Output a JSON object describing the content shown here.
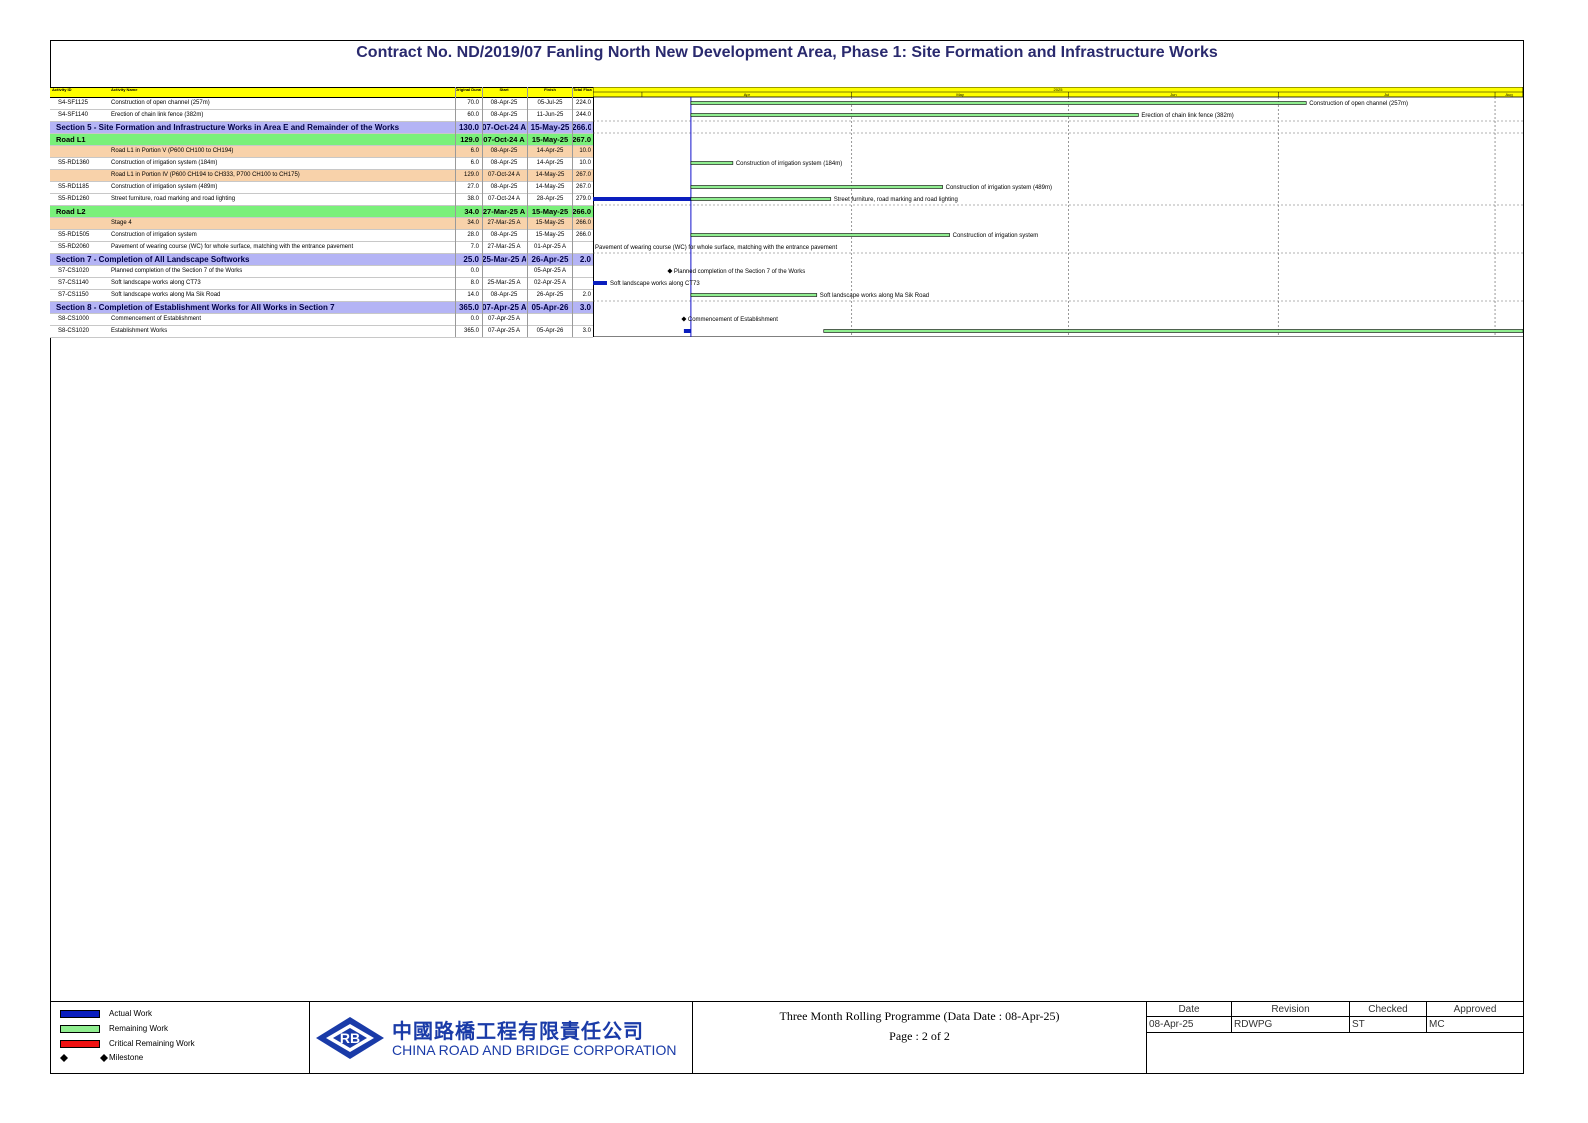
{
  "title": "Contract No. ND/2019/07 Fanling North New Development Area, Phase 1: Site Formation and Infrastructure Works",
  "table_header": {
    "id": "Activity ID",
    "name": "Activity Name",
    "duration": "Original Duration",
    "start": "Start",
    "finish": "Finish",
    "float": "Total Float"
  },
  "timeline": {
    "year": "2025",
    "months": [
      "Apr",
      "May",
      "Jun",
      "Jul",
      "Aug"
    ]
  },
  "chart_data": {
    "type": "gantt",
    "data_date": "2025-04-08",
    "axis_start": "2025-03-25",
    "axis_end": "2025-08-05",
    "rows": [
      {
        "kind": "act",
        "id": "S4-SF1125",
        "name": "Construction of open channel (257m)",
        "duration": "70.0",
        "start": "08-Apr-25",
        "finish": "05-Jul-25",
        "float": "224.0",
        "bar_start": "2025-04-08",
        "bar_end": "2025-07-05",
        "label": "Construction of open channel (257m)"
      },
      {
        "kind": "act",
        "id": "S4-SF1140",
        "name": "Erection of chain link fence (382m)",
        "duration": "60.0",
        "start": "08-Apr-25",
        "finish": "11-Jun-25",
        "float": "244.0",
        "bar_start": "2025-04-08",
        "bar_end": "2025-06-11",
        "label": "Erection of chain link fence (382m)"
      },
      {
        "kind": "section",
        "name": "Section 5 - Site Formation and Infrastructure Works in Area E and Remainder of the Works",
        "duration": "130.0",
        "start": "07-Oct-24 A",
        "finish": "15-May-25",
        "float": "266.0"
      },
      {
        "kind": "road",
        "name": "Road L1",
        "duration": "129.0",
        "start": "07-Oct-24 A",
        "finish": "15-May-25",
        "float": "267.0"
      },
      {
        "kind": "portion",
        "name": "Road L1 in Portion V (P600 CH100 to CH194)",
        "duration": "6.0",
        "start": "08-Apr-25",
        "finish": "14-Apr-25",
        "float": "10.0"
      },
      {
        "kind": "act",
        "id": "S5-RD1360",
        "name": "Construction of irrigation system (184m)",
        "duration": "6.0",
        "start": "08-Apr-25",
        "finish": "14-Apr-25",
        "float": "10.0",
        "bar_start": "2025-04-08",
        "bar_end": "2025-04-14",
        "label": "Construction of irrigation system (184m)"
      },
      {
        "kind": "portion",
        "name": "Road L1 in Portion IV (P600 CH194 to CH333, P700 CH100 to CH175)",
        "duration": "129.0",
        "start": "07-Oct-24 A",
        "finish": "14-May-25",
        "float": "267.0"
      },
      {
        "kind": "act",
        "id": "S5-RD1185",
        "name": "Construction of irrigation system (489m)",
        "duration": "27.0",
        "start": "08-Apr-25",
        "finish": "14-May-25",
        "float": "267.0",
        "bar_start": "2025-04-08",
        "bar_end": "2025-05-14",
        "label": "Construction of irrigation system (489m)"
      },
      {
        "kind": "act",
        "id": "S5-RD1260",
        "name": "Street furniture, road marking and road lighting",
        "duration": "38.0",
        "start": "07-Oct-24 A",
        "finish": "28-Apr-25",
        "float": "279.0",
        "bar_start": "2025-04-08",
        "bar_end": "2025-04-28",
        "actual_start": "2025-03-25",
        "label": "Street furniture, road marking and road lighting"
      },
      {
        "kind": "road",
        "name": "Road L2",
        "duration": "34.0",
        "start": "27-Mar-25 A",
        "finish": "15-May-25",
        "float": "266.0"
      },
      {
        "kind": "portion",
        "name": "Stage 4",
        "duration": "34.0",
        "start": "27-Mar-25 A",
        "finish": "15-May-25",
        "float": "266.0"
      },
      {
        "kind": "act",
        "id": "S5-RD1505",
        "name": "Construction of irrigation system",
        "duration": "28.0",
        "start": "08-Apr-25",
        "finish": "15-May-25",
        "float": "266.0",
        "bar_start": "2025-04-08",
        "bar_end": "2025-05-15",
        "label": "Construction of irrigation system"
      },
      {
        "kind": "act",
        "id": "S5-RD2060",
        "name": "Pavement of wearing course (WC) for whole surface, matching with the entrance pavement",
        "duration": "7.0",
        "start": "27-Mar-25 A",
        "finish": "01-Apr-25 A",
        "float": "",
        "label": "Pavement of wearing course (WC) for whole surface, matching with the entrance pavement"
      },
      {
        "kind": "section",
        "name": "Section 7 - Completion of All Landscape Softworks",
        "duration": "25.0",
        "start": "25-Mar-25 A",
        "finish": "26-Apr-25",
        "float": "2.0"
      },
      {
        "kind": "act",
        "id": "S7-CS1020",
        "name": "Planned completion of the Section 7 of the Works",
        "duration": "0.0",
        "start": "",
        "finish": "05-Apr-25 A",
        "float": "",
        "milestone": "2025-04-05",
        "label": "Planned completion of the Section 7 of the Works"
      },
      {
        "kind": "act",
        "id": "S7-CS1140",
        "name": "Soft landscape works along CT73",
        "duration": "8.0",
        "start": "25-Mar-25 A",
        "finish": "02-Apr-25 A",
        "float": "",
        "actual_start": "2025-03-25",
        "actual_end": "2025-03-27",
        "label": "Soft landscape works along CT73"
      },
      {
        "kind": "act",
        "id": "S7-CS1150",
        "name": "Soft landscape works along Ma Sik Road",
        "duration": "14.0",
        "start": "08-Apr-25",
        "finish": "26-Apr-25",
        "float": "2.0",
        "bar_start": "2025-04-08",
        "bar_end": "2025-04-26",
        "label": "Soft landscape works along Ma Sik Road"
      },
      {
        "kind": "section",
        "name": "Section 8 - Completion of Establishment Works for All Works in Section 7",
        "duration": "365.0",
        "start": "07-Apr-25 A",
        "finish": "05-Apr-26",
        "float": "3.0"
      },
      {
        "kind": "act",
        "id": "S8-CS1000",
        "name": "Commencement of Establishment",
        "duration": "0.0",
        "start": "07-Apr-25 A",
        "finish": "",
        "float": "",
        "milestone": "2025-04-07",
        "label": "Commencement of Establishment"
      },
      {
        "kind": "act",
        "id": "S8-CS1020",
        "name": "Establishment Works",
        "duration": "365.0",
        "start": "07-Apr-25 A",
        "finish": "05-Apr-26",
        "float": "3.0",
        "bar_start": "2025-04-27",
        "bar_end": "2025-08-05",
        "actual_start": "2025-04-07",
        "actual_end": "2025-04-08"
      }
    ]
  },
  "legend": {
    "items": [
      {
        "label": "Actual Work",
        "color": "#0a1ebe"
      },
      {
        "label": "Remaining Work",
        "color": "#90ee90"
      },
      {
        "label": "Critical Remaining Work",
        "color": "#ee1111"
      },
      {
        "label": "Milestone",
        "color": "#000000"
      }
    ]
  },
  "company": {
    "logo_text": "RB",
    "name_cn": "中國路橋工程有限責任公司",
    "name_en": "CHINA ROAD AND BRIDGE CORPORATION",
    "color": "#1a3ba8"
  },
  "programme": {
    "title": "Three Month Rolling Programme (Data Date : 08-Apr-25)",
    "page": "Page : 2 of 2"
  },
  "approval": {
    "headers": [
      "Date",
      "Revision",
      "Checked",
      "Approved"
    ],
    "values": [
      "08-Apr-25",
      "RDWPG",
      "ST",
      "MC"
    ]
  },
  "colors": {
    "header_yellow": "#ffff00",
    "section": "#b4b4f5",
    "road": "#7af07a",
    "portion": "#f8d2aa",
    "data_date_line": "#1111cc"
  }
}
